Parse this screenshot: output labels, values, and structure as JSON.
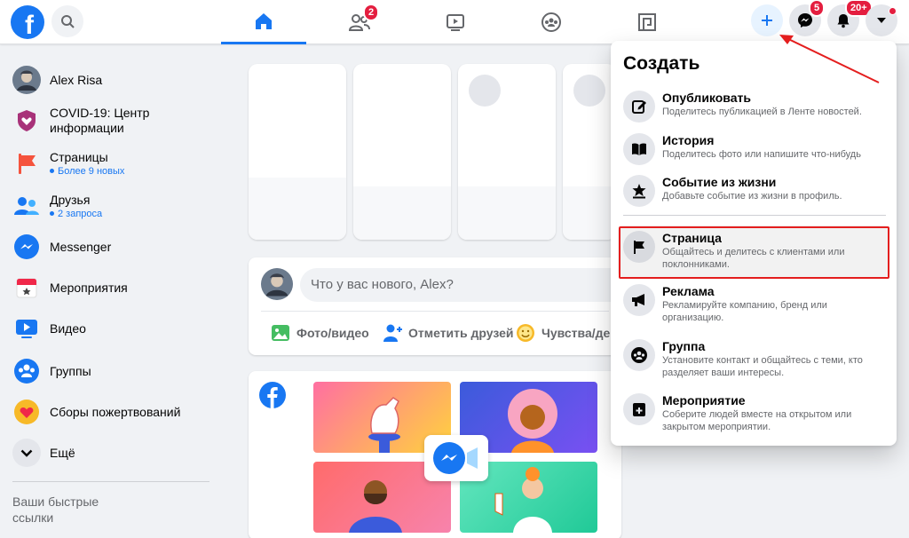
{
  "topbar": {
    "logo_letter": "f",
    "friends_badge": "2",
    "messenger_badge": "5",
    "notifications_badge": "20+",
    "accent": "#1877f2",
    "badge_color": "#e41e3f"
  },
  "sidebar": {
    "user_name": "Alex Risa",
    "items": [
      {
        "label": "COVID-19: Центр информации",
        "icon": "covid-icon"
      },
      {
        "label": "Страницы",
        "sub": "Более 9 новых",
        "icon": "flag-icon"
      },
      {
        "label": "Друзья",
        "sub": "2 запроса",
        "icon": "friends-icon"
      },
      {
        "label": "Messenger",
        "icon": "messenger-icon"
      },
      {
        "label": "Мероприятия",
        "icon": "calendar-icon"
      },
      {
        "label": "Видео",
        "icon": "video-icon"
      },
      {
        "label": "Группы",
        "icon": "groups-icon"
      },
      {
        "label": "Сборы пожертвований",
        "icon": "heart-icon"
      },
      {
        "label": "Ещё",
        "icon": "chevron-down-icon"
      }
    ],
    "quick_links": "Ваши быстрые ссылки"
  },
  "composer": {
    "placeholder": "Что у вас нового, Alex?",
    "photo_label": "Фото/видео",
    "tag_label": "Отметить друзей",
    "feeling_label": "Чувства/дей"
  },
  "create_menu": {
    "title": "Создать",
    "items": [
      {
        "label": "Опубликовать",
        "desc": "Поделитесь публикацией в Ленте новостей.",
        "icon": "edit-icon"
      },
      {
        "label": "История",
        "desc": "Поделитесь фото или напишите что-нибудь",
        "icon": "book-icon"
      },
      {
        "label": "Событие из жизни",
        "desc": "Добавьте событие из жизни в профиль.",
        "icon": "star-icon"
      },
      {
        "label": "Страница",
        "desc": "Общайтесь и делитесь с клиентами или поклонниками.",
        "icon": "flag-icon"
      },
      {
        "label": "Реклама",
        "desc": "Рекламируйте компанию, бренд или организацию.",
        "icon": "megaphone-icon"
      },
      {
        "label": "Группа",
        "desc": "Установите контакт и общайтесь с теми, кто разделяет ваши интересы.",
        "icon": "group-icon"
      },
      {
        "label": "Мероприятие",
        "desc": "Соберите людей вместе на открытом или закрытом мероприятии.",
        "icon": "event-icon"
      }
    ]
  }
}
